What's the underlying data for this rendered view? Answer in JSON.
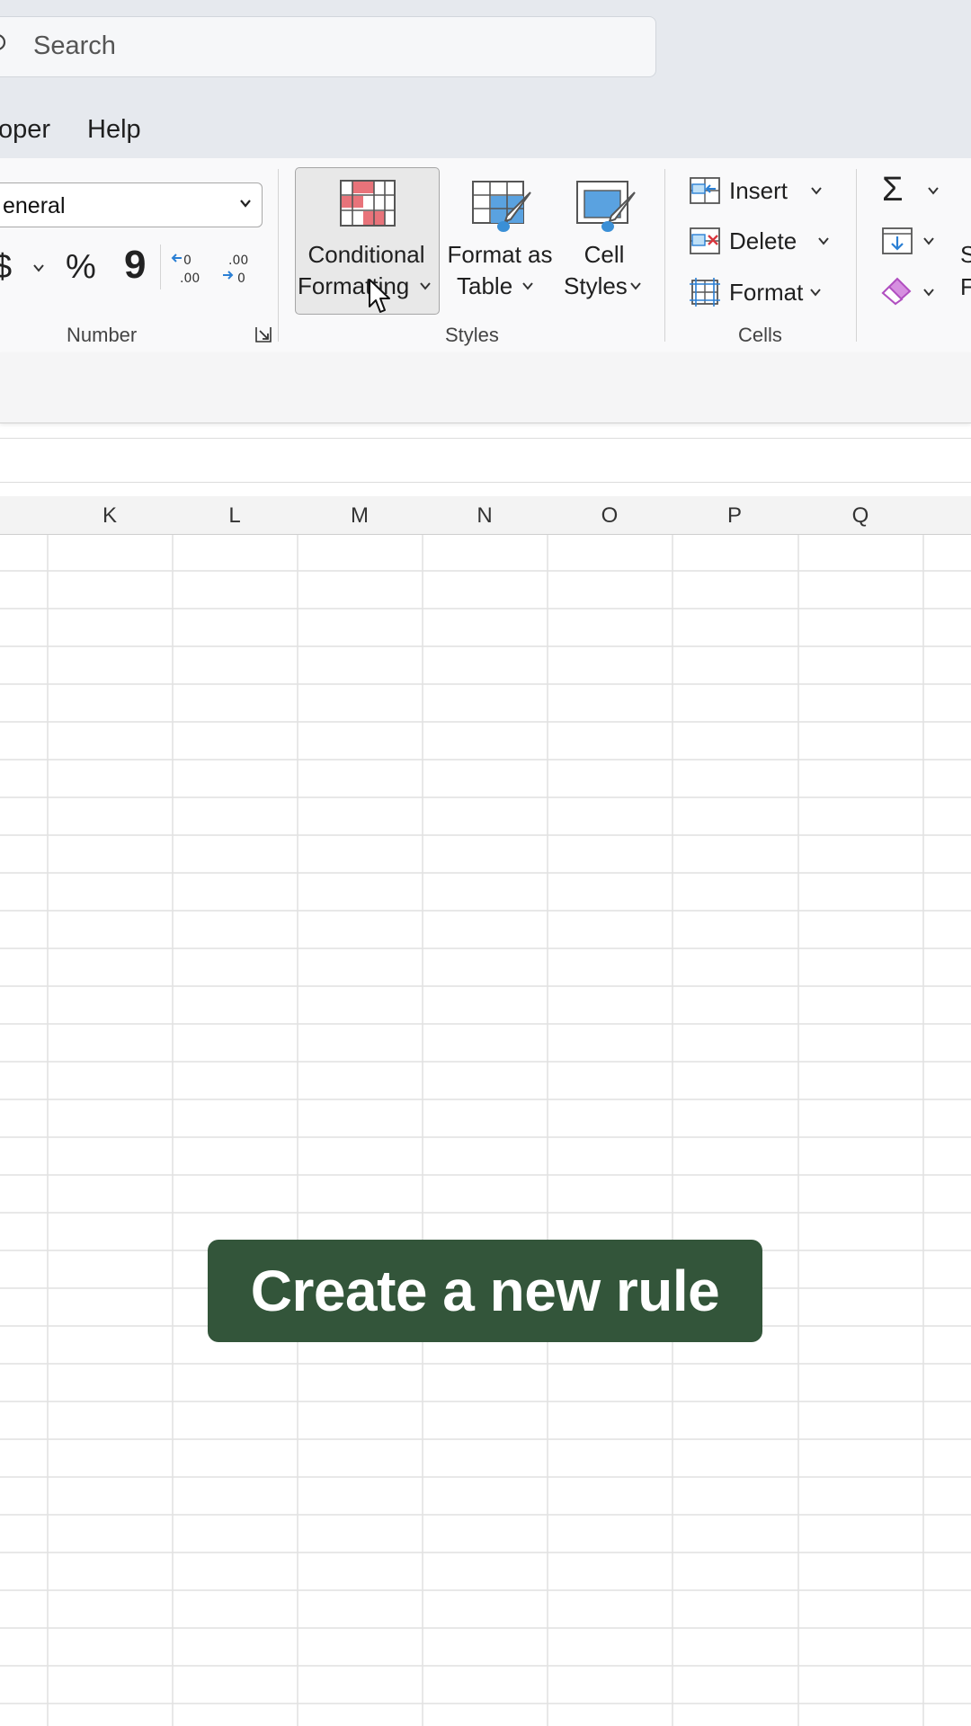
{
  "search": {
    "text": "Search"
  },
  "menu": {
    "items": [
      "oper",
      "Help"
    ]
  },
  "ribbon": {
    "number_group": {
      "format_value": "eneral",
      "currency_glyph": "$",
      "percent_glyph": "%",
      "comma_glyph": "9",
      "label": "Number"
    },
    "styles_group": {
      "conditional_formatting": {
        "line1": "Conditional",
        "line2": "Formatting"
      },
      "format_as_table": {
        "line1": "Format as",
        "line2": "Table"
      },
      "cell_styles": {
        "line1": "Cell",
        "line2": "Styles"
      },
      "label": "Styles"
    },
    "cells_group": {
      "insert": "Insert",
      "delete": "Delete",
      "format": "Format",
      "label": "Cells"
    },
    "editing_group": {
      "sum_glyph": "Σ",
      "cut_off_text": [
        "S",
        "F"
      ]
    }
  },
  "columns": [
    "K",
    "L",
    "M",
    "N",
    "O",
    "P",
    "Q"
  ],
  "overlay": {
    "caption": "Create a new rule",
    "color": "#33553a"
  },
  "colors": {
    "accent_red": "#e8737a",
    "accent_blue": "#3a8fd6",
    "eraser_purple": "#b04fc0"
  }
}
